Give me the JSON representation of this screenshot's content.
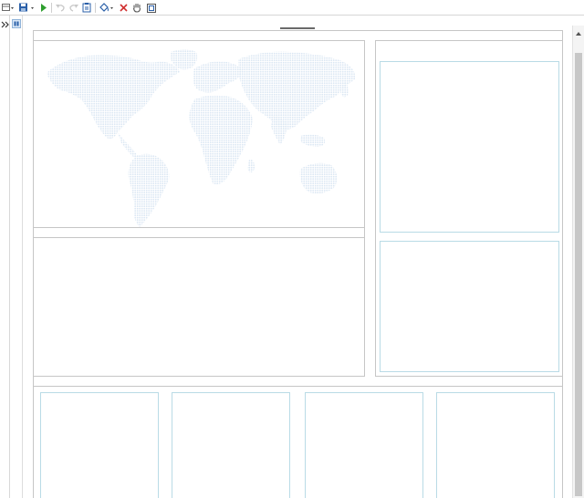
{
  "toolbar": {
    "buttons": [
      {
        "name": "layout-menu",
        "icon": "layout-grid-icon",
        "has_dropdown": true
      },
      {
        "name": "save",
        "icon": "floppy-disk-icon",
        "has_dropdown": true
      },
      {
        "name": "run",
        "icon": "play-icon"
      },
      {
        "name": "undo",
        "icon": "undo-arrow-icon",
        "enabled": false
      },
      {
        "name": "redo",
        "icon": "redo-arrow-icon",
        "enabled": false
      },
      {
        "name": "paste",
        "icon": "clipboard-icon"
      },
      {
        "name": "fill-color",
        "icon": "paint-bucket-icon",
        "has_dropdown": true
      },
      {
        "name": "delete",
        "icon": "red-x-icon"
      },
      {
        "name": "pan",
        "icon": "hand-icon"
      },
      {
        "name": "window",
        "icon": "window-frame-icon"
      }
    ]
  },
  "sidebar": {
    "expand_icon": "double-chevron-right-icon",
    "panel_icon": "panel-icon"
  },
  "dashboard": {
    "map_icon": "world-map-icon"
  },
  "colors": {
    "panel_border": "#c6c6c6",
    "placeholder_border": "#b9dbe6",
    "map_fill": "#dde9f4",
    "run_green": "#2e9e2e",
    "delete_red": "#d03030",
    "save_blue": "#2a5fa8"
  }
}
